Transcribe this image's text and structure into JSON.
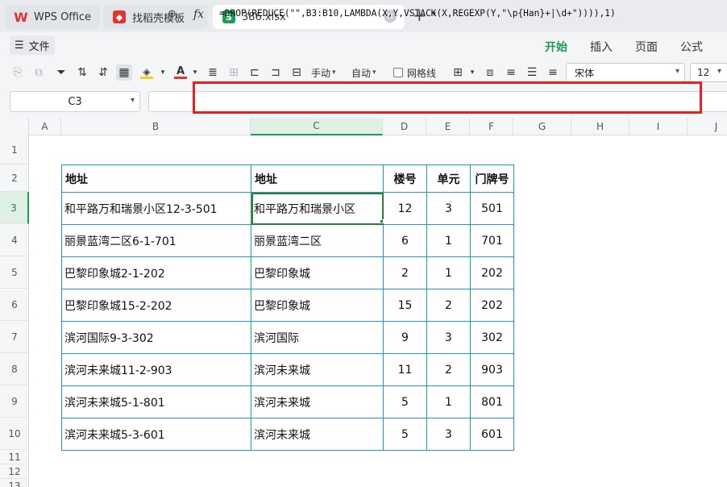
{
  "tabs": [
    {
      "label": "WPS Office",
      "icon": "wps-logo-icon"
    },
    {
      "label": "找稻壳模板",
      "icon": "docer-icon"
    },
    {
      "label": "386.xlsx",
      "icon": "spreadsheet-icon",
      "active": true
    }
  ],
  "menu": {
    "file_label": "文件",
    "ribbon_tabs": [
      "开始",
      "插入",
      "页面",
      "公式"
    ],
    "active_tab": "开始"
  },
  "toolbar": {
    "manual_label": "手动",
    "auto_label": "自动",
    "gridlines_label": "网格线",
    "font_name": "宋体",
    "font_size": "12",
    "fill_color": "#f5d40f",
    "font_color": "#e2342c"
  },
  "formula_bar": {
    "cell_ref": "C3",
    "fx_label": "fx",
    "formula": "=DROP(REDUCE(\"\",B3:B10,LAMBDA(X,Y,VSTACK(X,REGEXP(Y,\"\\p{Han}+|\\d+\")))),1)"
  },
  "columns": [
    "A",
    "B",
    "C",
    "D",
    "E",
    "F",
    "G",
    "H",
    "I",
    "J"
  ],
  "selected_column": "C",
  "rows": [
    "1",
    "2",
    "3",
    "4",
    "5",
    "6",
    "7",
    "8",
    "9",
    "10",
    "11",
    "12",
    "13"
  ],
  "selected_row": "3",
  "table": {
    "headers": [
      "地址",
      "地址",
      "楼号",
      "单元",
      "门牌号"
    ],
    "rows": [
      [
        "和平路万和瑞景小区12-3-501",
        "和平路万和瑞景小区",
        "12",
        "3",
        "501"
      ],
      [
        "丽景蓝湾二区6-1-701",
        "丽景蓝湾二区",
        "6",
        "1",
        "701"
      ],
      [
        "巴黎印象城2-1-202",
        "巴黎印象城",
        "2",
        "1",
        "202"
      ],
      [
        "巴黎印象城15-2-202",
        "巴黎印象城",
        "15",
        "2",
        "202"
      ],
      [
        "滨河国际9-3-302",
        "滨河国际",
        "9",
        "3",
        "302"
      ],
      [
        "滨河未来城11-2-903",
        "滨河未来城",
        "11",
        "2",
        "903"
      ],
      [
        "滨河未来城5-1-801",
        "滨河未来城",
        "5",
        "1",
        "801"
      ],
      [
        "滨河未来城5-3-601",
        "滨河未来城",
        "5",
        "3",
        "601"
      ]
    ]
  },
  "colors": {
    "accent": "#1f9b55",
    "highlight_border": "#e8211c",
    "table_border": "#1c9ec7"
  }
}
